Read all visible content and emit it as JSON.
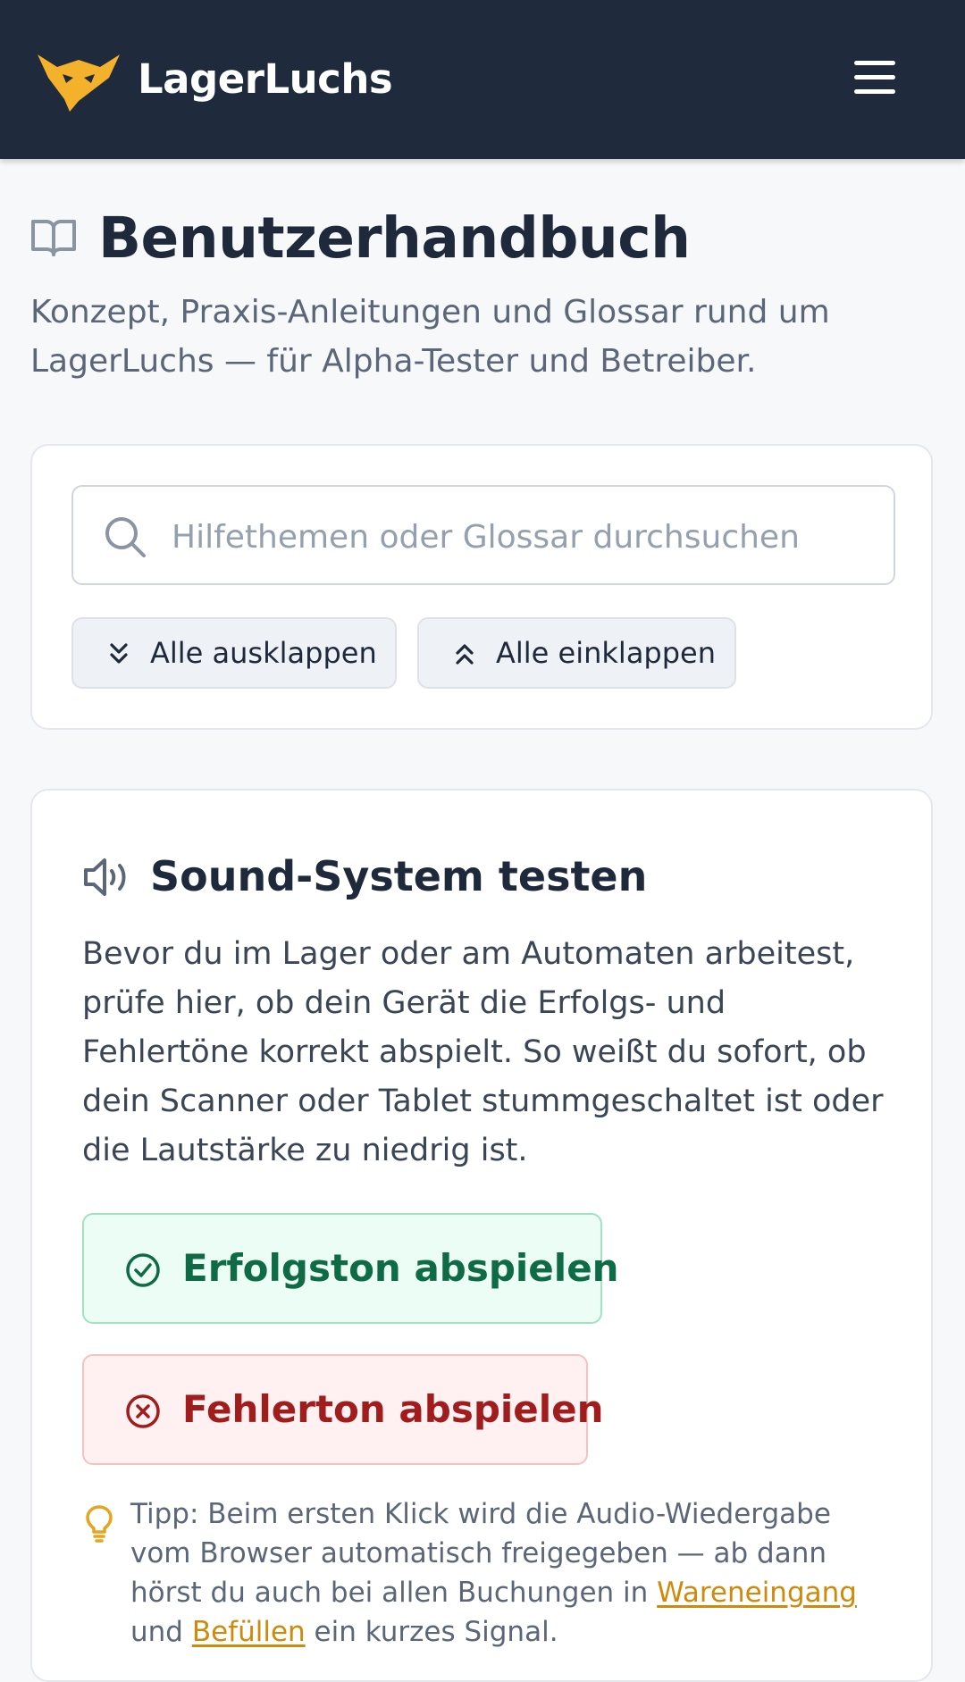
{
  "header": {
    "brand": "LagerLuchs",
    "logo_icon": "lynx-logo-icon",
    "menu_icon": "hamburger-menu-icon",
    "accent_color": "#f4b22c",
    "background_color": "#1f2a3c"
  },
  "page": {
    "icon": "book-open-icon",
    "title": "Benutzerhandbuch",
    "subtitle": "Konzept, Praxis-Anleitungen und Glossar rund um LagerLuchs — für Alpha-Tester und Betreiber."
  },
  "search": {
    "icon": "search-icon",
    "placeholder": "Hilfethemen oder Glossar durchsuchen",
    "value": "",
    "expand_all": "Alle ausklappen",
    "collapse_all": "Alle einklappen"
  },
  "sound_section": {
    "icon": "speaker-icon",
    "title": "Sound-System testen",
    "body": "Bevor du im Lager oder am Automaten arbeitest, prüfe hier, ob dein Gerät die Erfolgs- und Fehlertöne korrekt abspielt. So weißt du sofort, ob dein Scanner oder Tablet stummgeschaltet ist oder die Lautstärke zu niedrig ist.",
    "success_button": "Erfolgston abspielen",
    "error_button": "Fehlerton abspielen",
    "success_color": "#0f6b45",
    "error_color": "#a11c1c",
    "tip": {
      "icon": "lightbulb-icon",
      "text_before": "Tipp: Beim ersten Klick wird die Audio-Wiedergabe vom Browser automatisch freigegeben — ab dann hörst du auch bei allen Buchungen in ",
      "link1": "Wareneingang",
      "text_middle": " und ",
      "link2": "Befüllen",
      "text_after": " ein kurzes Signal."
    }
  }
}
